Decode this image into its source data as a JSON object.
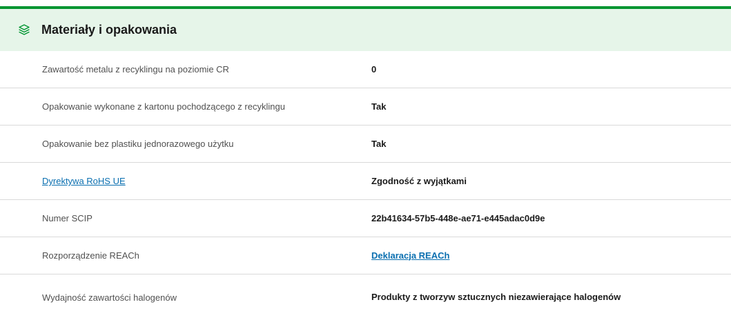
{
  "section": {
    "title": "Materiały i opakowania",
    "icon": "layers-icon",
    "accent_color": "#009530",
    "header_bg": "#e6f5e9",
    "link_color": "#0a6fb0"
  },
  "rows": [
    {
      "label": "Zawartość metalu z recyklingu na poziomie CR",
      "value": "0"
    },
    {
      "label": "Opakowanie wykonane z kartonu pochodzącego z recyklingu",
      "value": "Tak"
    },
    {
      "label": "Opakowanie bez plastiku jednorazowego użytku",
      "value": "Tak"
    },
    {
      "label": "Dyrektywa RoHS UE",
      "value": "Zgodność z wyjątkami"
    },
    {
      "label": "Numer SCIP",
      "value": "22b41634-57b5-448e-ae71-e445adac0d9e"
    },
    {
      "label": "Rozporządzenie REACh",
      "value": "Deklaracja REACh"
    },
    {
      "label": "Wydajność zawartości halogenów",
      "value": "Produkty z tworzyw sztucznych niezawierające halogenów"
    }
  ]
}
